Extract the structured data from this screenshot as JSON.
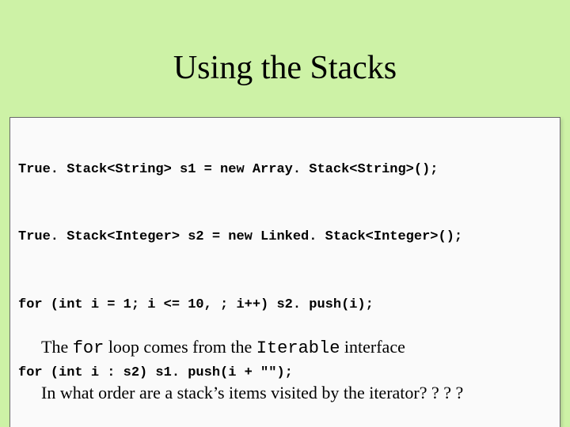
{
  "title": "Using the Stacks",
  "code": {
    "l1": "True. Stack<String> s1 = new Array. Stack<String>();",
    "l2": "True. Stack<Integer> s2 = new Linked. Stack<Integer>();",
    "l3": "for (int i = 1; i <= 10, ; i++) s2. push(i);",
    "l4": "for (int i : s2) s1. push(i + \"\");"
  },
  "body1": {
    "pre": "The ",
    "code1": "for",
    "mid": " loop comes from the ",
    "code2": "Iterable",
    "post": " interface"
  },
  "body2": "In what order are a stack’s items visited by the iterator? ? ? ?"
}
